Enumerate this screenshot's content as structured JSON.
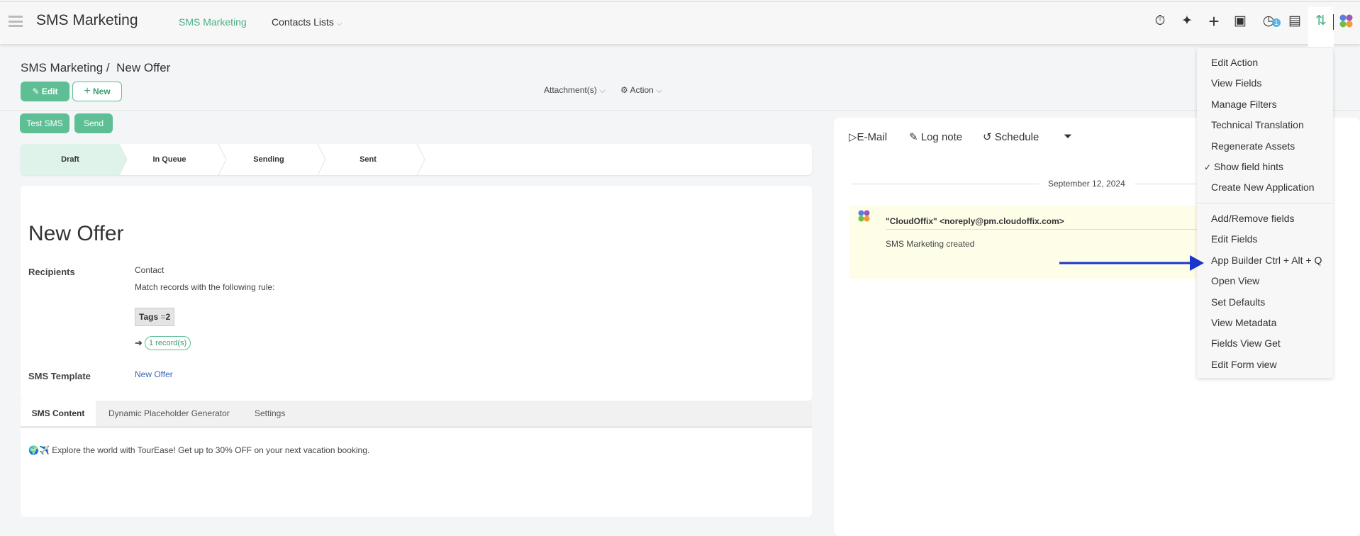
{
  "header": {
    "app_title": "SMS Marketing",
    "nav": [
      {
        "label": "SMS Marketing",
        "active": true
      },
      {
        "label": "Contacts Lists",
        "dropdown": true
      }
    ],
    "icons": [
      "stopwatch-icon",
      "sparkle-icon",
      "plus-icon",
      "calendar-check-icon",
      "clock-icon",
      "chat-icon",
      "settings-sliders-icon",
      "apps-logo-icon"
    ],
    "activity_badge": "1"
  },
  "breadcrumb": {
    "parent": "SMS Marketing /",
    "current": "New Offer"
  },
  "toolbar": {
    "edit": "Edit",
    "new": "New",
    "attachments": "Attachment(s)",
    "action": "Action",
    "test_sms": "Test SMS",
    "send": "Send"
  },
  "stages": [
    {
      "label": "Draft",
      "active": true
    },
    {
      "label": "In Queue"
    },
    {
      "label": "Sending"
    },
    {
      "label": "Sent"
    }
  ],
  "form": {
    "title": "New Offer",
    "recipients_label": "Recipients",
    "recipients_model": "Contact",
    "rule_text": "Match records with the following rule:",
    "tag_field": "Tags",
    "tag_op": "=",
    "tag_value": "2",
    "records": "1 record(s)",
    "template_label": "SMS Template",
    "template_value": "New Offer"
  },
  "tabs": [
    {
      "label": "SMS Content",
      "active": true
    },
    {
      "label": "Dynamic Placeholder Generator"
    },
    {
      "label": "Settings"
    }
  ],
  "sms_content": "🌍✈️ Explore the world with TourEase! Get up to 30% OFF on your next vacation booking.",
  "chatter": {
    "email": "E-Mail",
    "log_note": "Log note",
    "schedule": "Schedule",
    "date": "September 12, 2024",
    "author": "\"CloudOffix\" <noreply@pm.cloudoffix.com>",
    "body": "SMS Marketing created"
  },
  "menu": {
    "group1": [
      {
        "label": "Edit Action"
      },
      {
        "label": "View Fields"
      },
      {
        "label": "Manage Filters"
      },
      {
        "label": "Technical Translation"
      },
      {
        "label": "Regenerate Assets"
      },
      {
        "label": "Show field hints",
        "checked": true
      },
      {
        "label": "Create New Application"
      }
    ],
    "group2": [
      {
        "label": "Add/Remove fields"
      },
      {
        "label": "Edit Fields"
      },
      {
        "label": "App Builder Ctrl + Alt + Q"
      },
      {
        "label": "Open View"
      },
      {
        "label": "Set Defaults"
      },
      {
        "label": "View Metadata"
      },
      {
        "label": "Fields View Get"
      },
      {
        "label": "Edit Form view"
      }
    ]
  },
  "colors": {
    "accent": "#5ebf95",
    "arrow": "#1a35c9",
    "link": "#3a66b5",
    "message_bg": "#fdfde8"
  }
}
